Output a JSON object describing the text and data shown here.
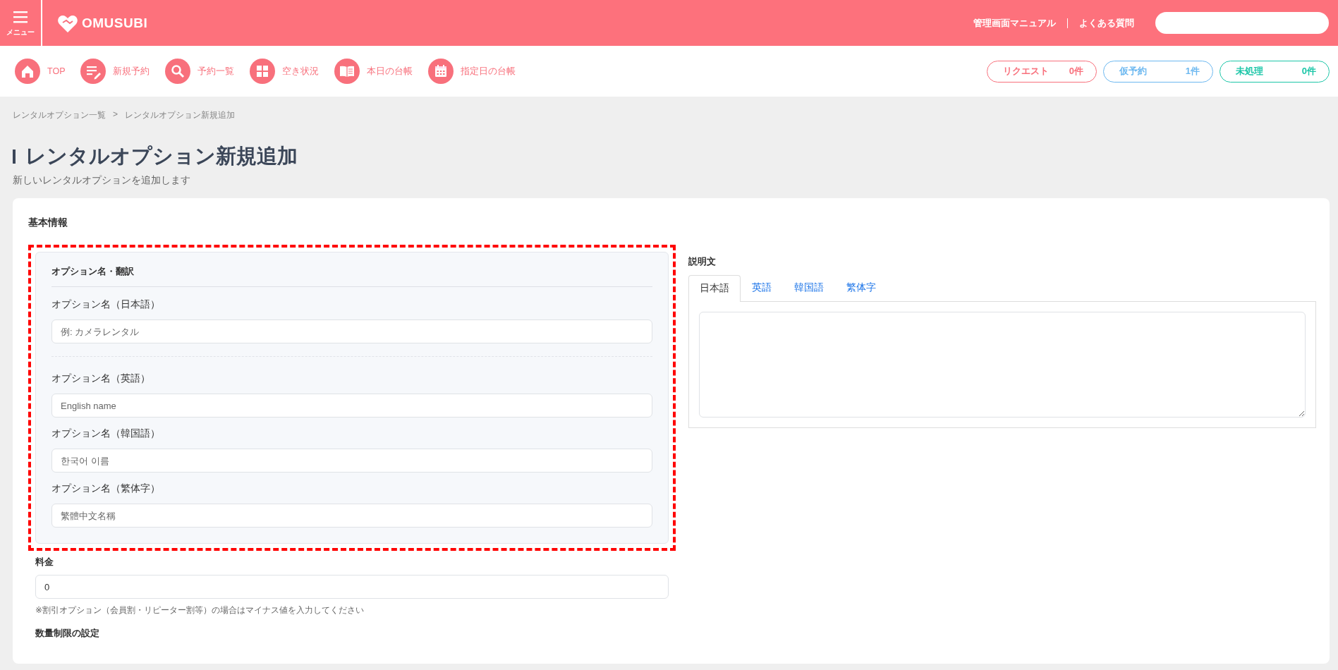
{
  "header": {
    "menu_label": "メニュー",
    "logo_text": "OMUSUBI",
    "links": [
      "管理画面マニュアル",
      "よくある質問"
    ],
    "search_field": true
  },
  "nav": {
    "items": [
      {
        "label": "TOP"
      },
      {
        "label": "新規予約"
      },
      {
        "label": "予約一覧"
      },
      {
        "label": "空き状況"
      },
      {
        "label": "本日の台帳"
      },
      {
        "label": "指定日の台帳"
      }
    ],
    "badges": [
      {
        "label": "リクエスト",
        "count": "0件",
        "color": "#f8707c"
      },
      {
        "label": "仮予約",
        "count": "1件",
        "color": "#6cb8f0"
      },
      {
        "label": "未処理",
        "count": "0件",
        "color": "#1cc6a8"
      }
    ]
  },
  "breadcrumb": [
    "レンタルオプション一覧",
    ">",
    "レンタルオプション新規追加"
  ],
  "page": {
    "title": "レンタルオプション新規追加",
    "subtitle": "新しいレンタルオプションを追加します"
  },
  "card": {
    "title": "基本情報",
    "translations": {
      "highlighted": true,
      "title": "オプション名・翻訳",
      "fields": [
        {
          "label": "オプション名（日本語）",
          "placeholder": "例: カメラレンタル",
          "separator_after": true
        },
        {
          "label": "オプション名（英語）",
          "placeholder": "English name",
          "separator_after": false
        },
        {
          "label": "オプション名（韓国語）",
          "placeholder": "한국어 이름",
          "separator_after": false
        },
        {
          "label": "オプション名（繁体字）",
          "placeholder": "繁體中文名稱",
          "separator_after": false
        }
      ]
    },
    "price": {
      "label": "料金",
      "value": "0",
      "note": "※割引オプション（会員割・リピーター割等）の場合はマイナス値を入力してください"
    },
    "quantity_label": "数量制限の設定",
    "description": {
      "label": "説明文",
      "tabs": [
        {
          "label": "日本語",
          "selected": true
        },
        {
          "label": "英語",
          "selected": false
        },
        {
          "label": "韓国語",
          "selected": false
        },
        {
          "label": "繁体字",
          "selected": false
        }
      ]
    }
  }
}
